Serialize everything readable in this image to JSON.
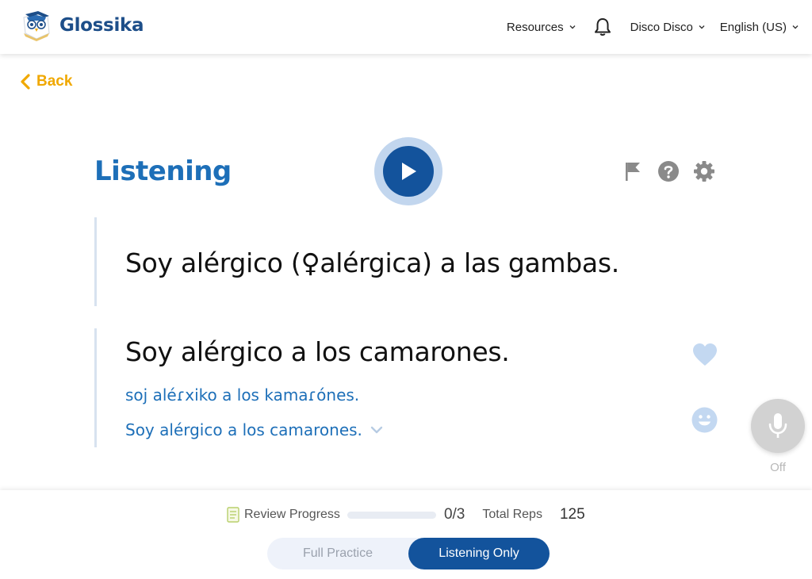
{
  "brand": {
    "name": "Glossika"
  },
  "nav": {
    "resources": "Resources",
    "user": "Disco Disco",
    "language": "English (US)"
  },
  "back_label": "Back",
  "section_title": "Listening",
  "sentences": {
    "prompt": "Soy alérgico (♀alérgica) a las gambas.",
    "target": "Soy alérgico a los camarones.",
    "ipa": "soj aléɾxiko a los kamaɾónes.",
    "translation": "Soy alérgico a los camarones."
  },
  "mic": {
    "state_label": "Off"
  },
  "footer": {
    "review_progress_label": "Review Progress",
    "review_progress_fraction": 0.0,
    "review_count": "0/3",
    "total_reps_label": "Total Reps",
    "total_reps_value": "125",
    "mode_options": [
      "Full Practice",
      "Listening Only"
    ],
    "selected_mode": "Listening Only"
  },
  "icons": {
    "notifications": "bell-icon",
    "report": "flag-icon",
    "help": "help-icon",
    "settings": "gear-icon",
    "favorite": "heart-icon",
    "feedback": "smiley-icon",
    "record": "microphone-icon",
    "play": "play-icon"
  },
  "colors": {
    "brand_blue": "#1d6fb8",
    "dark_blue": "#13539c",
    "accent_yellow": "#f0a800",
    "light_blue": "#c2d6ee"
  }
}
